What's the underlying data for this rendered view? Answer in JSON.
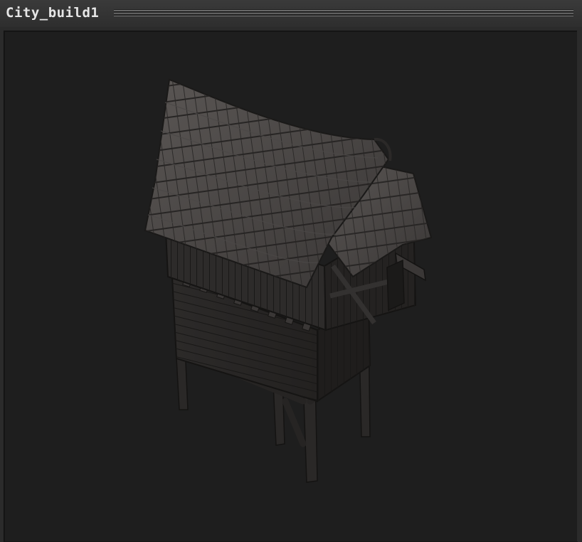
{
  "window": {
    "title": "City_build1"
  },
  "viewport": {
    "background_color": "#1e1e1e",
    "model_icon": "building-model-icon"
  }
}
